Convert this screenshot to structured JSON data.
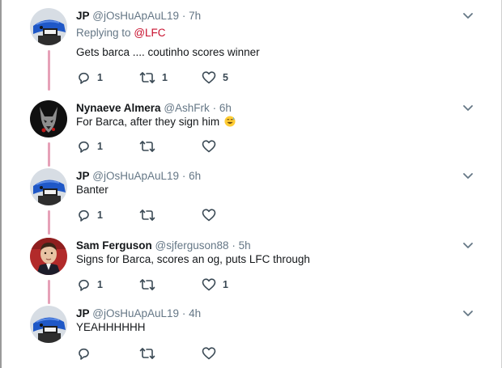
{
  "colors": {
    "accent": "#c8102e",
    "thread_line": "#e6a1b8",
    "muted": "#657786",
    "text": "#14171a"
  },
  "tweets": [
    {
      "name": "JP",
      "handle": "@jOsHuApAuL19",
      "dot": "·",
      "time": "7h",
      "replying_prefix": "Replying to",
      "replying_to": "@LFC",
      "text": "Gets barca .... coutinho scores winner",
      "reply_count": "1",
      "retweet_count": "1",
      "like_count": "5",
      "avatar": "blue-helmet-avatar"
    },
    {
      "name": "Nynaeve Almera",
      "handle": "@AshFrk",
      "dot": "·",
      "time": "6h",
      "text": "For Barca, after they sign him",
      "emoji": "grinning-sweat-emoji",
      "reply_count": "1",
      "retweet_count": "",
      "like_count": "",
      "avatar": "wolf-avatar"
    },
    {
      "name": "JP",
      "handle": "@jOsHuApAuL19",
      "dot": "·",
      "time": "6h",
      "text": "Banter",
      "reply_count": "1",
      "retweet_count": "",
      "like_count": "",
      "avatar": "blue-helmet-avatar"
    },
    {
      "name": "Sam Ferguson",
      "handle": "@sjferguson88",
      "dot": "·",
      "time": "5h",
      "text": "Signs for Barca, scores an og, puts LFC through",
      "reply_count": "1",
      "retweet_count": "",
      "like_count": "1",
      "avatar": "man-portrait-avatar"
    },
    {
      "name": "JP",
      "handle": "@jOsHuApAuL19",
      "dot": "·",
      "time": "4h",
      "text": "YEAHHHHHH",
      "reply_count": "",
      "retweet_count": "",
      "like_count": "",
      "avatar": "blue-helmet-avatar"
    }
  ]
}
